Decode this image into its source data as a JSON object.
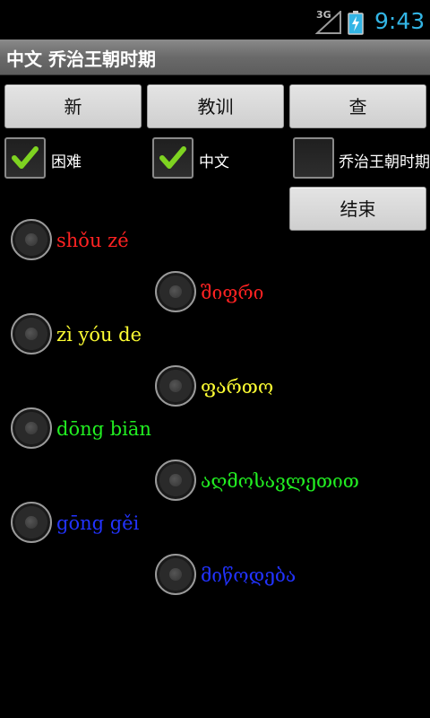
{
  "status_bar": {
    "network": "3G",
    "time": "9:43",
    "clock_color": "#33b5e5",
    "icons": [
      "signal-icon",
      "battery-charging-icon"
    ]
  },
  "title_bar": {
    "title": "中文 乔治王朝时期"
  },
  "buttons": {
    "new": "新",
    "lesson": "教训",
    "lookup": "查",
    "end": "结束"
  },
  "checkboxes": [
    {
      "label": "困难",
      "checked": true
    },
    {
      "label": "中文",
      "checked": true
    },
    {
      "label": "乔治王朝时期",
      "checked": false
    }
  ],
  "options_left": [
    {
      "text": "shǒu zé",
      "color": "#ff2222"
    },
    {
      "text": "zì yóu de",
      "color": "#ffff33"
    },
    {
      "text": "dōng biān",
      "color": "#22ee22"
    },
    {
      "text": "gōng gěi",
      "color": "#2233ff"
    }
  ],
  "options_right": [
    {
      "text": "შიფრი",
      "color": "#ff2222"
    },
    {
      "text": "ფართო",
      "color": "#ffff33"
    },
    {
      "text": "აღმოსავლეთით",
      "color": "#22ee22"
    },
    {
      "text": "მიწოდება",
      "color": "#2233ff"
    }
  ]
}
